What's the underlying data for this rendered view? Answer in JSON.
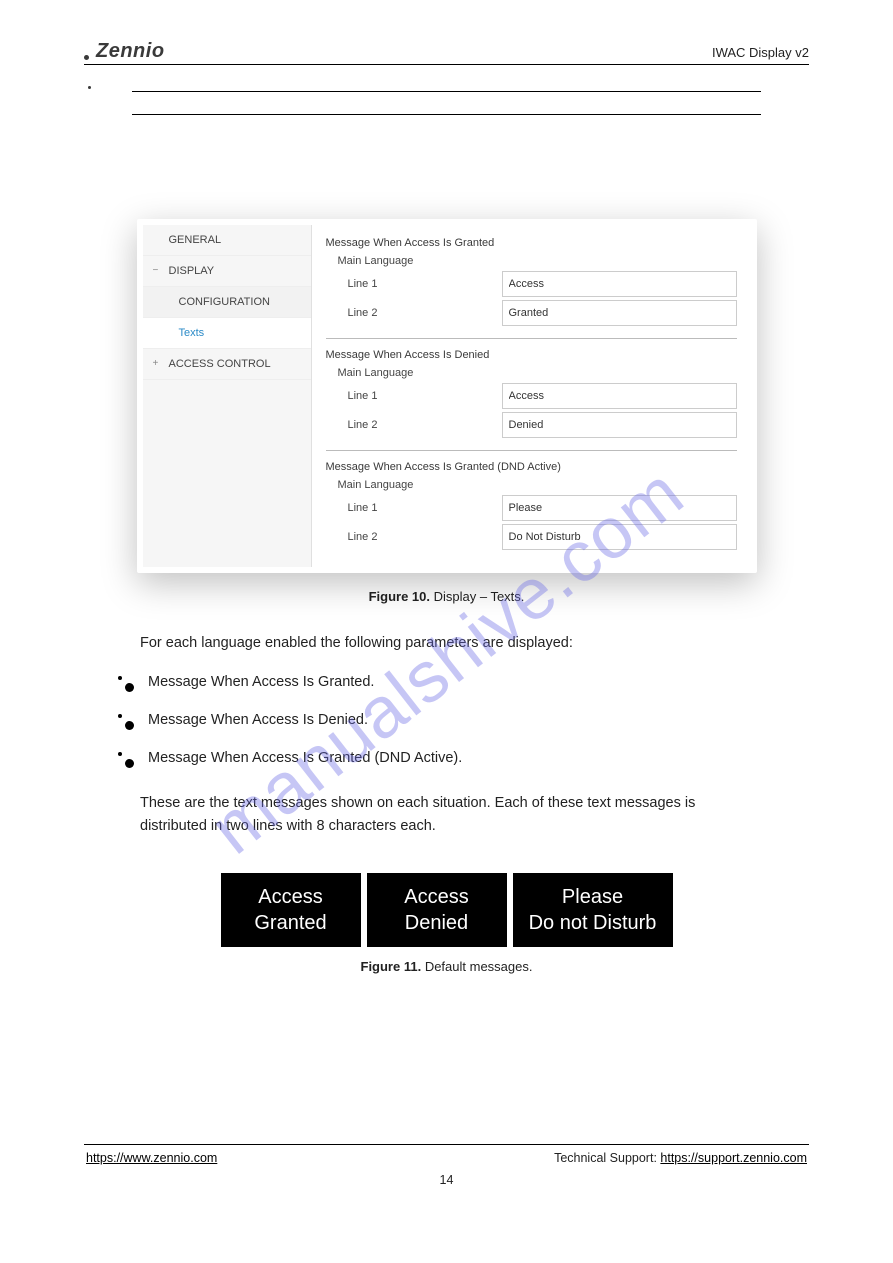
{
  "header": {
    "brand": "Zennio",
    "doc_title": "IWAC Display v2"
  },
  "sidebar": {
    "items": [
      {
        "label": "GENERAL",
        "kind": "top"
      },
      {
        "label": "DISPLAY",
        "kind": "top",
        "toggle": "−"
      },
      {
        "label": "CONFIGURATION",
        "kind": "nested"
      },
      {
        "label": "Texts",
        "kind": "active"
      },
      {
        "label": "ACCESS CONTROL",
        "kind": "top",
        "toggle": "+"
      }
    ]
  },
  "form": {
    "sections": [
      {
        "title": "Message When Access Is Granted",
        "subtitle": "Main Language",
        "rows": [
          {
            "label": "Line 1",
            "value": "Access"
          },
          {
            "label": "Line 2",
            "value": "Granted"
          }
        ]
      },
      {
        "title": "Message When Access Is Denied",
        "subtitle": "Main Language",
        "rows": [
          {
            "label": "Line 1",
            "value": "Access"
          },
          {
            "label": "Line 2",
            "value": "Denied"
          }
        ]
      },
      {
        "title": "Message When Access Is Granted (DND Active)",
        "subtitle": "Main Language",
        "rows": [
          {
            "label": "Line 1",
            "value": "Please"
          },
          {
            "label": "Line 2",
            "value": "Do Not Disturb"
          }
        ]
      }
    ]
  },
  "fig1": {
    "bold": "Figure 10.",
    "rest": " Display – Texts."
  },
  "intro": "For each language enabled the following parameters are displayed:",
  "bullets": [
    "Message When Access Is Granted.",
    "Message When Access Is Denied.",
    "Message When Access Is Granted (DND Active)."
  ],
  "para": "These are the text messages shown on each situation. Each of these text messages is distributed in two lines with 8 characters each.",
  "tiles": [
    [
      "Access",
      "Granted"
    ],
    [
      "Access",
      "Denied"
    ],
    [
      "Please",
      "Do not Disturb"
    ]
  ],
  "fig2": {
    "bold": "Figure 11.",
    "rest": " Default messages."
  },
  "footer": {
    "left_url": "https://www.zennio.com",
    "left_text": "https://www.zennio.com",
    "right": "Technical Support: ",
    "right_url": "https://support.zennio.com",
    "right_text": "https://support.zennio.com"
  },
  "watermark": "manualshive.com",
  "page_number": "14"
}
